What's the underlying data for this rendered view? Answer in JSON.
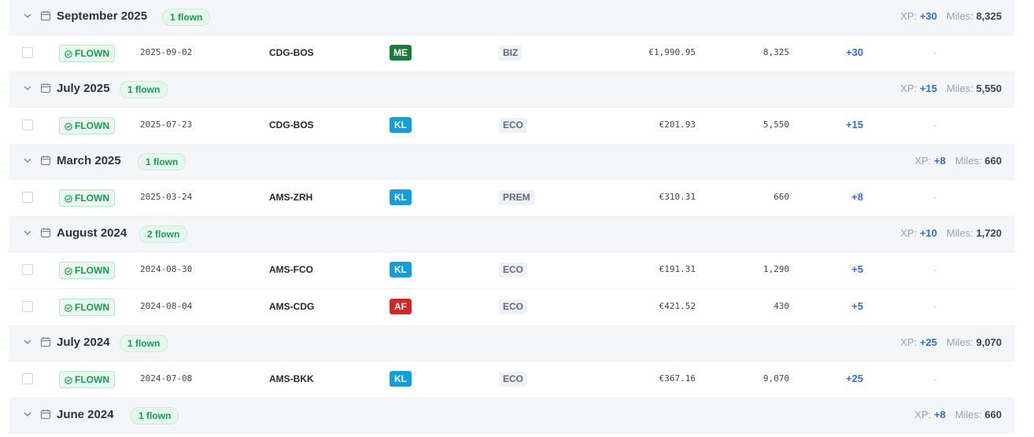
{
  "labels": {
    "xp": "XP:",
    "miles": "Miles:",
    "flown_status": "FLOWN",
    "empty_value": "-"
  },
  "airline_colors": {
    "ME": "#1f7a3a",
    "KL": "#139fdc",
    "AF": "#d42626"
  },
  "groups": [
    {
      "title": "September 2025",
      "badge": "1 flown",
      "xp_total": "+30",
      "miles_total": "8,325",
      "flights": [
        {
          "date": "2025-09-02",
          "route": "CDG-BOS",
          "airline": "ME",
          "cabin": "BIZ",
          "price": "€1,990.95",
          "miles": "8,325",
          "xp": "+30"
        }
      ]
    },
    {
      "title": "July 2025",
      "badge": "1 flown",
      "xp_total": "+15",
      "miles_total": "5,550",
      "flights": [
        {
          "date": "2025-07-23",
          "route": "CDG-BOS",
          "airline": "KL",
          "cabin": "ECO",
          "price": "€201.93",
          "miles": "5,550",
          "xp": "+15"
        }
      ]
    },
    {
      "title": "March 2025",
      "badge": "1 flown",
      "xp_total": "+8",
      "miles_total": "660",
      "flights": [
        {
          "date": "2025-03-24",
          "route": "AMS-ZRH",
          "airline": "KL",
          "cabin": "PREM",
          "price": "€310.31",
          "miles": "660",
          "xp": "+8"
        }
      ]
    },
    {
      "title": "August 2024",
      "badge": "2 flown",
      "xp_total": "+10",
      "miles_total": "1,720",
      "flights": [
        {
          "date": "2024-08-30",
          "route": "AMS-FCO",
          "airline": "KL",
          "cabin": "ECO",
          "price": "€191.31",
          "miles": "1,290",
          "xp": "+5"
        },
        {
          "date": "2024-08-04",
          "route": "AMS-CDG",
          "airline": "AF",
          "cabin": "ECO",
          "price": "€421.52",
          "miles": "430",
          "xp": "+5"
        }
      ]
    },
    {
      "title": "July 2024",
      "badge": "1 flown",
      "xp_total": "+25",
      "miles_total": "9,070",
      "flights": [
        {
          "date": "2024-07-08",
          "route": "AMS-BKK",
          "airline": "KL",
          "cabin": "ECO",
          "price": "€367.16",
          "miles": "9,070",
          "xp": "+25"
        }
      ]
    },
    {
      "title": "June 2024",
      "badge": "1 flown",
      "xp_total": "+8",
      "miles_total": "660",
      "flights": []
    }
  ]
}
